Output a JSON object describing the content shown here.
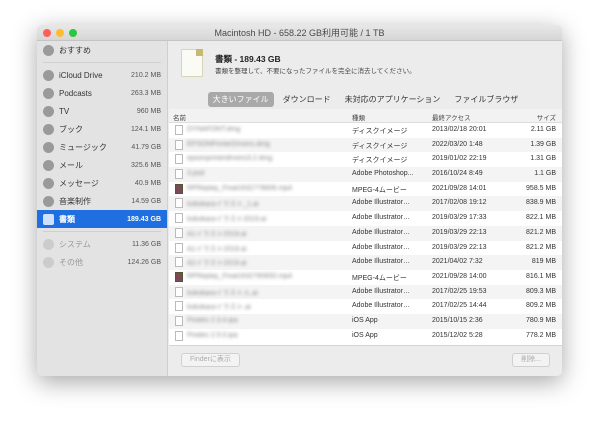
{
  "window": {
    "title": "Macintosh HD - 658.22 GB利用可能 / 1 TB"
  },
  "sidebar": {
    "recommend": {
      "label": "おすすめ"
    },
    "items": [
      {
        "label": "iCloud Drive",
        "size": "210.2 MB",
        "icon": "cloud-icon"
      },
      {
        "label": "Podcasts",
        "size": "263.3 MB",
        "icon": "podcast-icon"
      },
      {
        "label": "TV",
        "size": "960 MB",
        "icon": "tv-icon"
      },
      {
        "label": "ブック",
        "size": "124.1 MB",
        "icon": "book-icon"
      },
      {
        "label": "ミュージック",
        "size": "41.79 GB",
        "icon": "music-icon"
      },
      {
        "label": "メール",
        "size": "325.6 MB",
        "icon": "mail-icon"
      },
      {
        "label": "メッセージ",
        "size": "40.9 MB",
        "icon": "message-icon"
      },
      {
        "label": "音楽制作",
        "size": "14.59 GB",
        "icon": "music-creation-icon"
      },
      {
        "label": "書類",
        "size": "189.43 GB",
        "icon": "documents-icon"
      }
    ],
    "system": [
      {
        "label": "システム",
        "size": "11.36 GB"
      },
      {
        "label": "その他",
        "size": "124.26 GB"
      }
    ]
  },
  "header": {
    "title": "書類 - 189.43 GB",
    "subtitle": "書類を整理して、不要になったファイルを完全に消去してください。"
  },
  "tabs": [
    "大きいファイル",
    "ダウンロード",
    "未対応のアプリケーション",
    "ファイルブラウザ"
  ],
  "columns": {
    "name": "名前",
    "kind": "種類",
    "date": "最終アクセス",
    "size": "サイズ"
  },
  "files": [
    {
      "name": "DYNAFONT.dmg",
      "kind": "ディスクイメージ",
      "date": "2013/02/18 20:01",
      "size": "2.11 GB",
      "type": "doc"
    },
    {
      "name": "EPSONPrinterDrivers.dmg",
      "kind": "ディスクイメージ",
      "date": "2022/03/20 1:48",
      "size": "1.39 GB",
      "type": "doc"
    },
    {
      "name": "epsonprinterdrivers3.2.dmg",
      "kind": "ディスクイメージ",
      "date": "2019/01/02 22:19",
      "size": "1.31 GB",
      "type": "doc"
    },
    {
      "name": "3.psd",
      "kind": "Adobe Photoshop...",
      "date": "2016/10/24 8:49",
      "size": "1.1 GB",
      "type": "doc"
    },
    {
      "name": "RPReplay_Final1632778606.mp4",
      "kind": "MPEG-4ムービー",
      "date": "2021/09/28 14:01",
      "size": "958.5 MB",
      "type": "vid"
    },
    {
      "name": "kokokaraイラスト_1.ai",
      "kind": "Adobe Illustrator…",
      "date": "2017/02/08 19:12",
      "size": "838.9 MB",
      "type": "doc"
    },
    {
      "name": "kokokaraイラスト2019.ai",
      "kind": "Adobe Illustrator…",
      "date": "2019/03/29 17:33",
      "size": "822.1 MB",
      "type": "doc"
    },
    {
      "name": "A1イラスト2019.ai",
      "kind": "Adobe Illustrator…",
      "date": "2019/03/29 22:13",
      "size": "821.2 MB",
      "type": "doc"
    },
    {
      "name": "A1イラスト2019.ai",
      "kind": "Adobe Illustrator…",
      "date": "2019/03/29 22:13",
      "size": "821.2 MB",
      "type": "doc"
    },
    {
      "name": "A2イラスト2019.ai",
      "kind": "Adobe Illustrator…",
      "date": "2021/04/02 7:32",
      "size": "819 MB",
      "type": "doc"
    },
    {
      "name": "RPReplay_Final1632780650.mp4",
      "kind": "MPEG-4ムービー",
      "date": "2021/09/28 14:00",
      "size": "816.1 MB",
      "type": "vid"
    },
    {
      "name": "kokokaraイラスト入.ai",
      "kind": "Adobe Illustrator…",
      "date": "2017/02/25 19:53",
      "size": "809.3 MB",
      "type": "doc"
    },
    {
      "name": "kokokaraイラスト.ai",
      "kind": "Adobe Illustrator…",
      "date": "2017/02/25 14:44",
      "size": "809.2 MB",
      "type": "doc"
    },
    {
      "name": "Pirates 2.3.4.ipa",
      "kind": "iOS App",
      "date": "2015/10/15 2:36",
      "size": "780.9 MB",
      "type": "doc"
    },
    {
      "name": "Pirates 2.5.0.ipa",
      "kind": "iOS App",
      "date": "2015/12/02 5:28",
      "size": "778.2 MB",
      "type": "doc"
    }
  ],
  "buttons": {
    "finder": "Finderに表示",
    "delete": "削除..."
  }
}
